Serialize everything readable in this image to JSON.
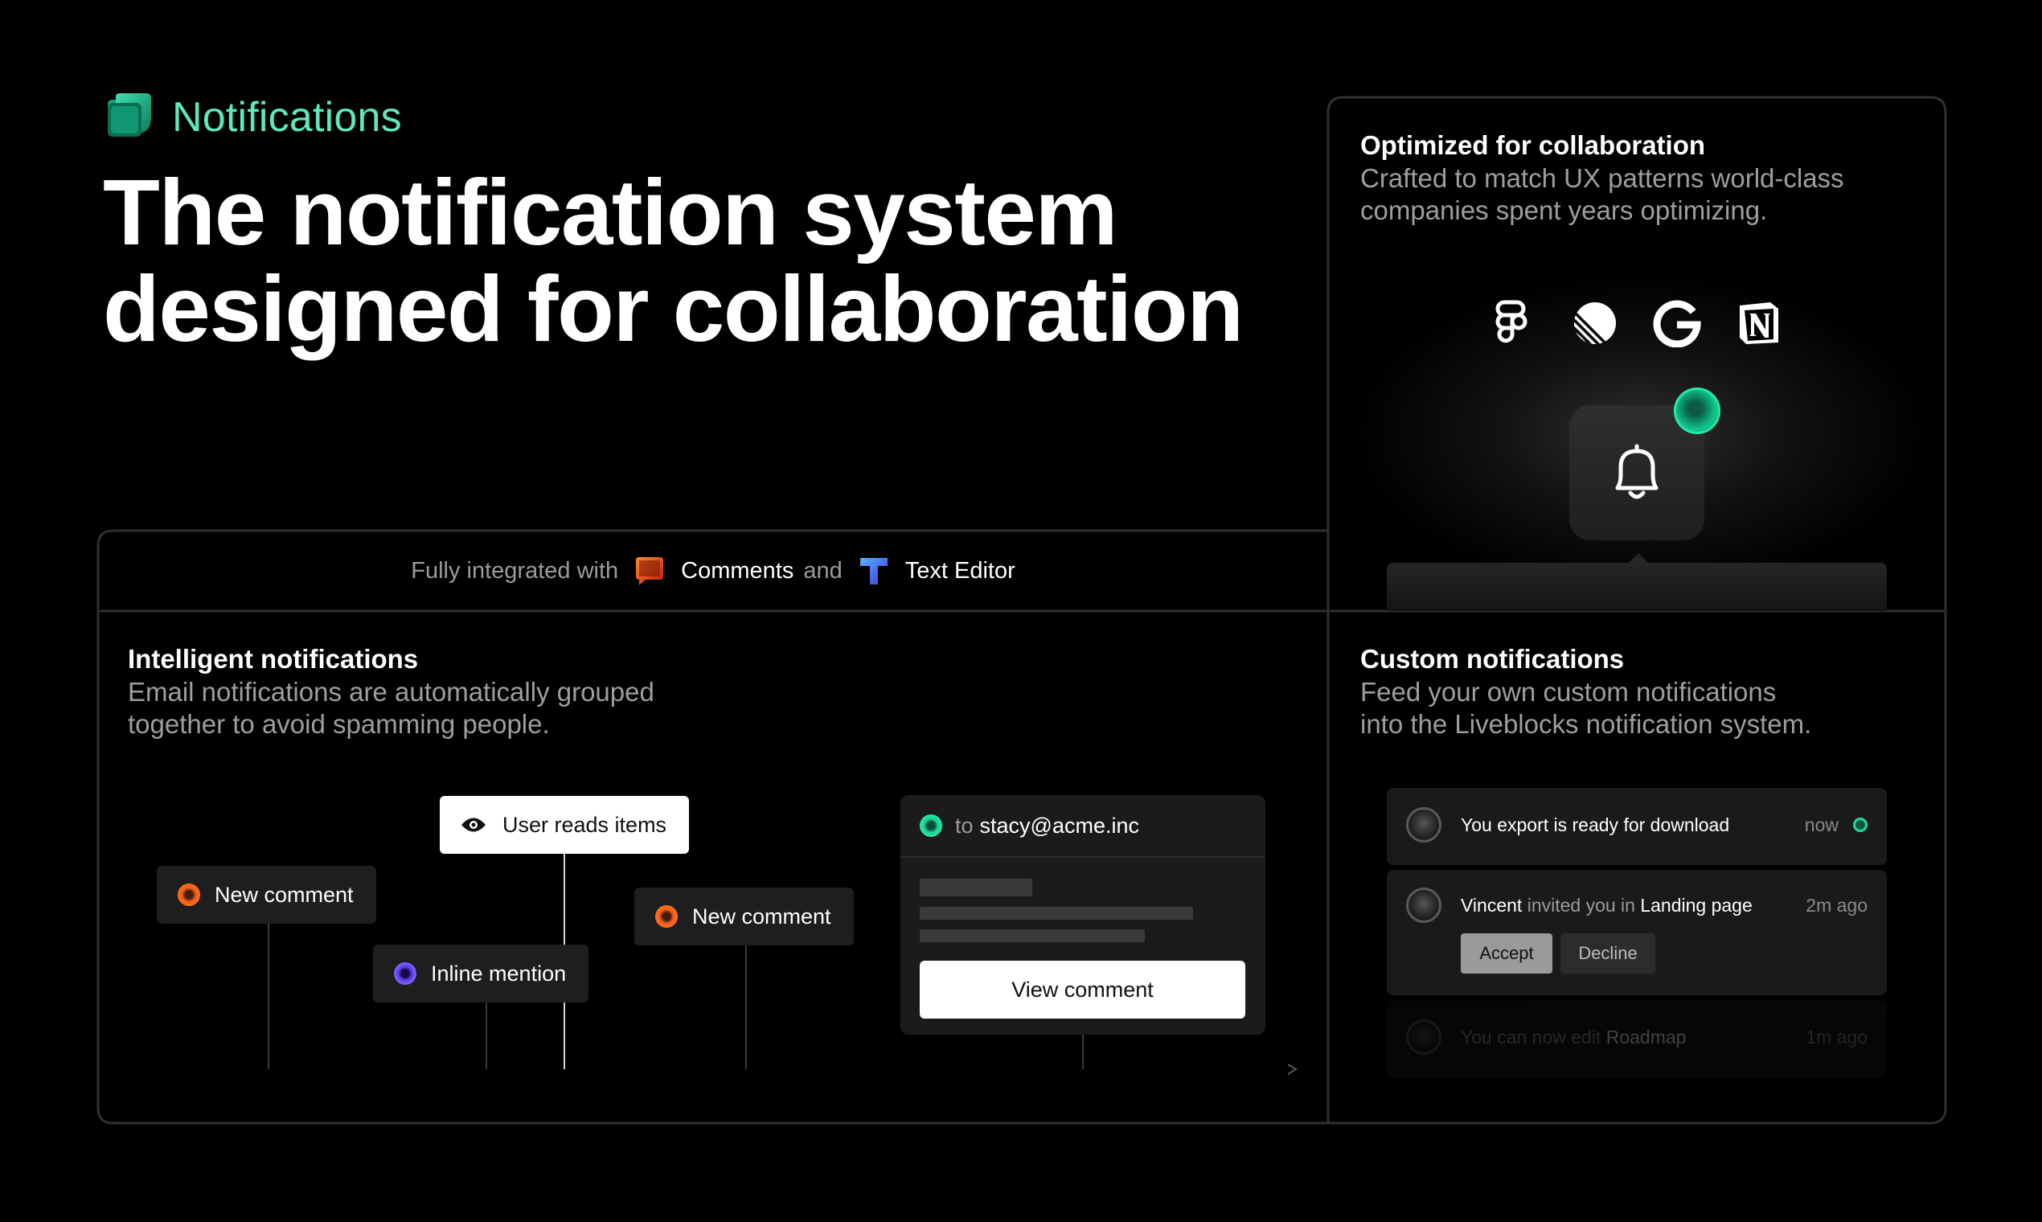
{
  "header": {
    "brand_label": "Notifications",
    "headline_line1": "The notification system",
    "headline_line2": "designed for collaboration"
  },
  "integration": {
    "prefix": "Fully integrated with",
    "comments_label": "Comments",
    "joiner": "and",
    "editor_label": "Text Editor"
  },
  "cards": {
    "intelligent": {
      "title": "Intelligent notifications",
      "desc_line1": "Email notifications are automatically grouped",
      "desc_line2": "together to avoid spamming people."
    },
    "collaboration": {
      "title": "Optimized for collaboration",
      "desc_line1": "Crafted to match UX patterns world-class",
      "desc_line2": "companies spent years optimizing."
    },
    "custom": {
      "title": "Custom notifications",
      "desc_line1": "Feed your own custom notifications",
      "desc_line2": "into the Liveblocks notification system."
    }
  },
  "timeline": {
    "user_reads": "User reads items",
    "event1": "New comment",
    "event2": "Inline mention",
    "event3": "New comment"
  },
  "email": {
    "to_label": "to",
    "address": "stacy@acme.inc",
    "button": "View comment"
  },
  "brand_icons": [
    "figma-icon",
    "linear-icon",
    "google-icon",
    "notion-icon"
  ],
  "notifications": [
    {
      "text": "You export is ready for download",
      "time": "now",
      "unread": true
    },
    {
      "actor": "Vincent",
      "middle": "invited you in",
      "target": "Landing page",
      "time": "2m ago",
      "accept": "Accept",
      "decline": "Decline"
    },
    {
      "prefix": "You can now edit",
      "target": "Roadmap",
      "time": "1m ago"
    }
  ],
  "colors": {
    "accent": "#5ee8bd",
    "orange_dot": "#ff6a1a",
    "purple_dot": "#7a5aff",
    "green_dot": "#1ee8a0"
  }
}
